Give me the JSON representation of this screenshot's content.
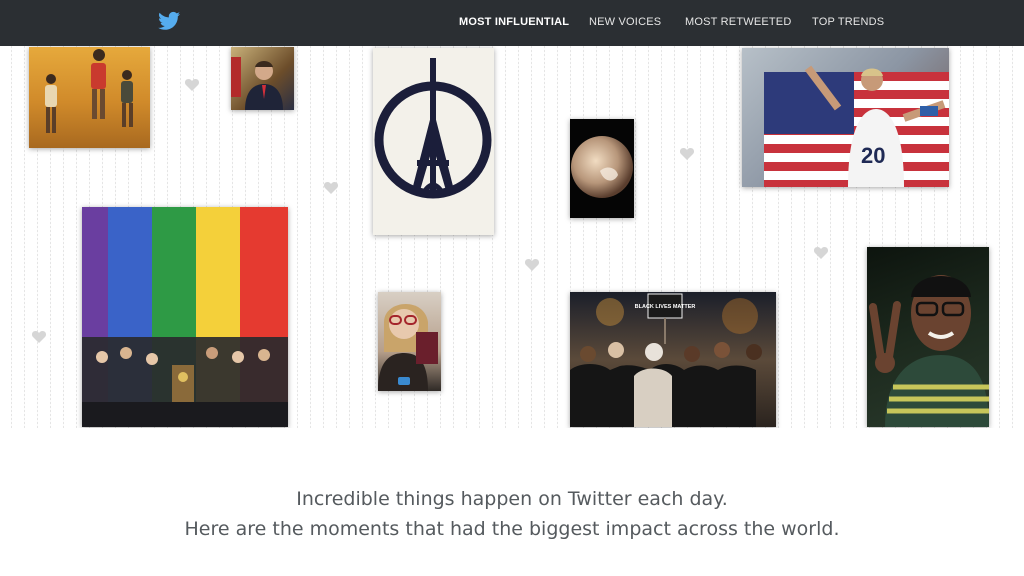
{
  "nav": {
    "items": [
      {
        "label": "MOST INFLUENTIAL",
        "active": true
      },
      {
        "label": "NEW VOICES",
        "active": false
      },
      {
        "label": "MOST RETWEETED",
        "active": false
      },
      {
        "label": "TOP TRENDS",
        "active": false
      }
    ]
  },
  "collage": {
    "photo_texts": {
      "jersey_number": "20",
      "protest_sign": "BLACK LIVES MATTER"
    },
    "heart_color": "#d6d6d6"
  },
  "tagline": {
    "line1": "Incredible things happen on Twitter each day.",
    "line2": "Here are the moments that had the biggest impact across the world."
  },
  "colors": {
    "topbar": "#2b2f33",
    "brand": "#55acee",
    "text": "#555a5e"
  },
  "icons": {
    "logo": "twitter-bird-icon",
    "decor": "heart-icon"
  }
}
